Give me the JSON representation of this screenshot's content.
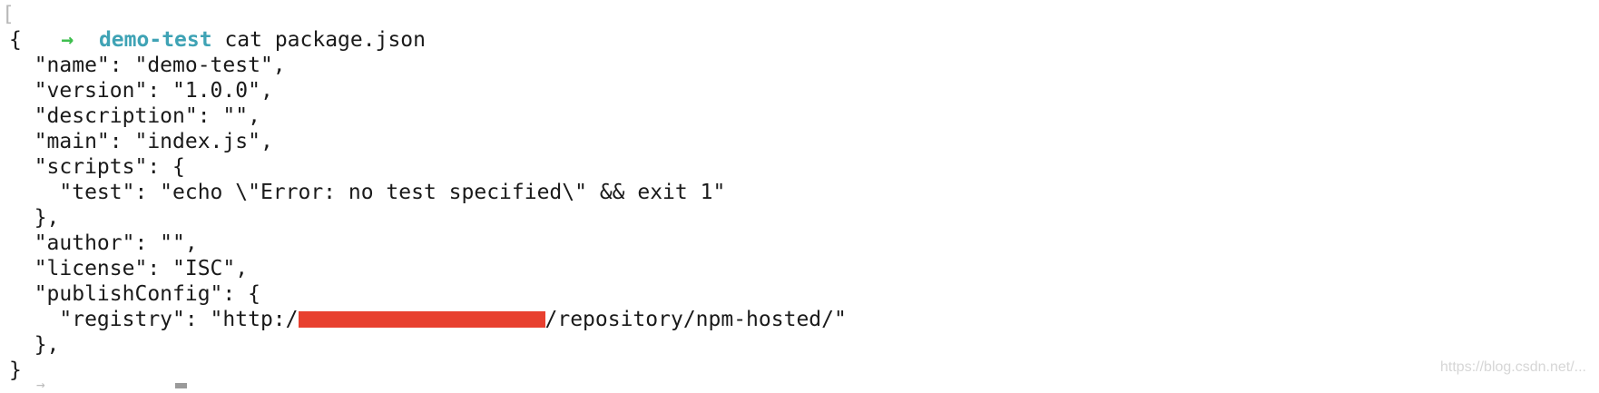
{
  "prompt": {
    "bracket": "[",
    "arrow": "→",
    "directory": "demo-test",
    "command": "cat package.json"
  },
  "output": {
    "l01": "{",
    "l02": "  \"name\": \"demo-test\",",
    "l03": "  \"version\": \"1.0.0\",",
    "l04": "  \"description\": \"\",",
    "l05": "  \"main\": \"index.js\",",
    "l06": "  \"scripts\": {",
    "l07": "    \"test\": \"echo \\\"Error: no test specified\\\" && exit 1\"",
    "l08": "  },",
    "l09": "  \"author\": \"\",",
    "l10": "  \"license\": \"ISC\",",
    "l11": "  \"publishConfig\": {",
    "l12_prefix": "    \"registry\": \"http:/",
    "l12_suffix": "/repository/npm-hosted/\"",
    "l13": "  },",
    "l14": "}"
  },
  "watermark": "https://blog.csdn.net/...",
  "colors": {
    "arrow": "#3fbf4f",
    "directory": "#3fa3b5",
    "redaction": "#e8402f"
  }
}
